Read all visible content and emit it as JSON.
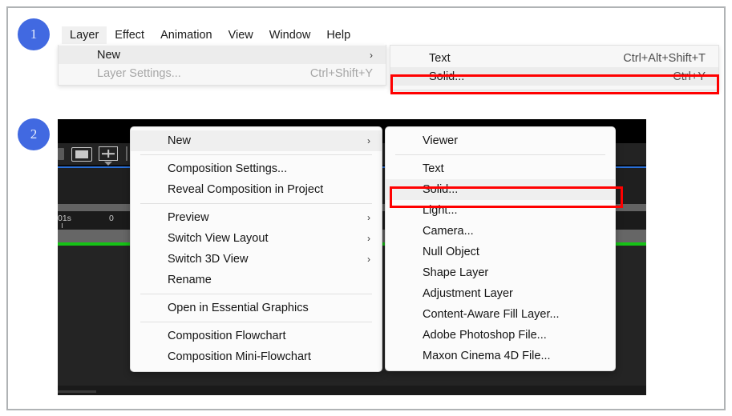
{
  "badges": [
    {
      "name": "step-1",
      "text": "1"
    },
    {
      "name": "step-2",
      "text": "2"
    }
  ],
  "panel1": {
    "menubar": [
      {
        "label": "Layer",
        "open": true
      },
      {
        "label": "Effect",
        "open": false
      },
      {
        "label": "Animation",
        "open": false
      },
      {
        "label": "View",
        "open": false
      },
      {
        "label": "Window",
        "open": false
      },
      {
        "label": "Help",
        "open": false
      }
    ],
    "layer_menu": [
      {
        "label": "New",
        "accel": "",
        "submenu": true,
        "highlighted": true,
        "disabled": false
      },
      {
        "label": "Layer Settings...",
        "accel": "Ctrl+Shift+Y",
        "submenu": false,
        "highlighted": false,
        "disabled": true
      }
    ],
    "new_submenu": [
      {
        "label": "Text",
        "accel": "Ctrl+Alt+Shift+T",
        "boxed": false
      },
      {
        "label": "Solid...",
        "accel": "Ctrl+Y",
        "boxed": true
      }
    ]
  },
  "panel2": {
    "timeline": {
      "tick_left": "01s",
      "tick_right": "0"
    },
    "icons": [
      "panel-menu-icon",
      "screen-icon",
      "region-of-interest-icon",
      "toolbar-divider"
    ],
    "context_menu": [
      {
        "label": "New",
        "submenu": true,
        "highlighted": true
      },
      {
        "separator": true
      },
      {
        "label": "Composition Settings...",
        "submenu": false,
        "highlighted": false
      },
      {
        "label": "Reveal Composition in Project",
        "submenu": false,
        "highlighted": false
      },
      {
        "separator": true
      },
      {
        "label": "Preview",
        "submenu": true,
        "highlighted": false
      },
      {
        "label": "Switch View Layout",
        "submenu": true,
        "highlighted": false
      },
      {
        "label": "Switch 3D View",
        "submenu": true,
        "highlighted": false
      },
      {
        "label": "Rename",
        "submenu": false,
        "highlighted": false
      },
      {
        "separator": true
      },
      {
        "label": "Open in Essential Graphics",
        "submenu": false,
        "highlighted": false
      },
      {
        "separator": true
      },
      {
        "label": "Composition Flowchart",
        "submenu": false,
        "highlighted": false
      },
      {
        "label": "Composition Mini-Flowchart",
        "submenu": false,
        "highlighted": false
      }
    ],
    "new_submenu": [
      {
        "label": "Viewer",
        "boxed": false
      },
      {
        "separator": true
      },
      {
        "label": "Text",
        "boxed": false
      },
      {
        "label": "Solid...",
        "boxed": true
      },
      {
        "label": "Light...",
        "boxed": false
      },
      {
        "label": "Camera...",
        "boxed": false
      },
      {
        "label": "Null Object",
        "boxed": false
      },
      {
        "label": "Shape Layer",
        "boxed": false
      },
      {
        "label": "Adjustment Layer",
        "boxed": false
      },
      {
        "label": "Content-Aware Fill Layer...",
        "boxed": false
      },
      {
        "label": "Adobe Photoshop File...",
        "boxed": false
      },
      {
        "label": "Maxon Cinema 4D File...",
        "boxed": false
      }
    ]
  },
  "colors": {
    "badge": "#4169e1",
    "highlight_box": "#ff0000",
    "menu_bg": "#fbfbfb",
    "timeline_green": "#16c216",
    "timeline_blue": "#2a6fd6"
  },
  "glyphs": {
    "chevron_right": "›"
  }
}
